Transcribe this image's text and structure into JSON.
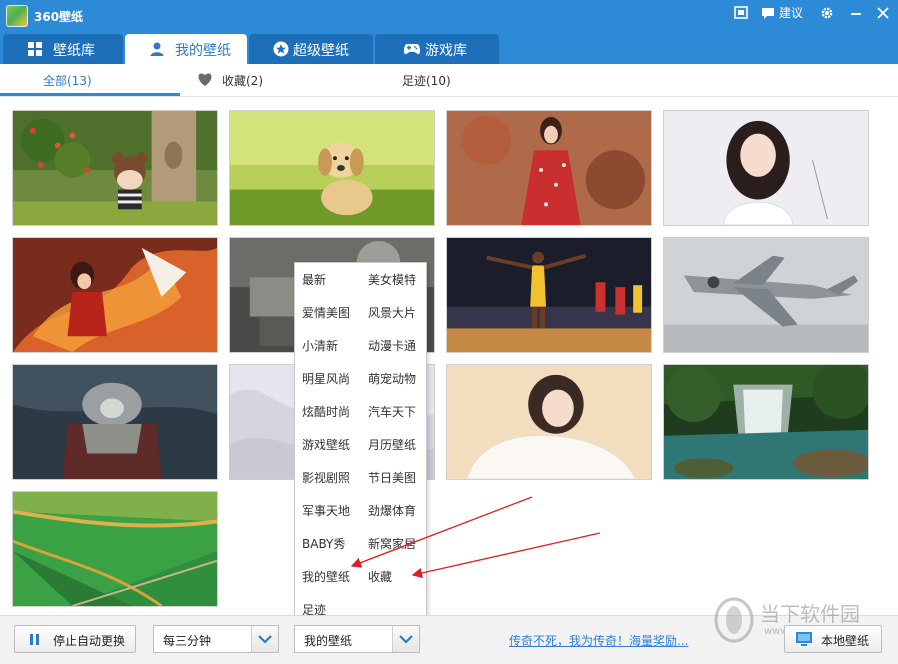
{
  "window": {
    "title": "360壁纸",
    "suggest_label": "建议"
  },
  "main_tabs": [
    {
      "label": "壁纸库",
      "icon": "grid-icon"
    },
    {
      "label": "我的壁纸",
      "icon": "user-icon"
    },
    {
      "label": "超级壁纸",
      "icon": "star-icon"
    },
    {
      "label": "游戏库",
      "icon": "gamepad-icon"
    }
  ],
  "sub_tabs": [
    {
      "label": "全部(13)"
    },
    {
      "label": "收藏(2)",
      "icon": "heart-icon"
    },
    {
      "label": "足迹(10)"
    }
  ],
  "wallpapers": [
    {
      "subject": "figurine-in-garden"
    },
    {
      "subject": "puppy-on-grass"
    },
    {
      "subject": "girl-in-red-dress"
    },
    {
      "subject": "girl-portrait"
    },
    {
      "subject": "game-character-fire"
    },
    {
      "subject": "mech-robot"
    },
    {
      "subject": "basketball-players"
    },
    {
      "subject": "fighter-jet"
    },
    {
      "subject": "masked-warrior"
    },
    {
      "subject": "white-fabric"
    },
    {
      "subject": "girl-in-sunlight"
    },
    {
      "subject": "waterfall"
    },
    {
      "subject": "green-fields"
    }
  ],
  "category_menu": {
    "items": [
      [
        "最新",
        "美女模特"
      ],
      [
        "爱情美图",
        "风景大片"
      ],
      [
        "小清新",
        "动漫卡通"
      ],
      [
        "明星风尚",
        "萌宠动物"
      ],
      [
        "炫酷时尚",
        "汽车天下"
      ],
      [
        "游戏壁纸",
        "月历壁纸"
      ],
      [
        "影视剧照",
        "节日美图"
      ],
      [
        "军事天地",
        "劲爆体育"
      ],
      [
        "BABY秀",
        "新窝家居"
      ],
      [
        "我的壁纸",
        "收藏"
      ],
      [
        "足迹",
        ""
      ]
    ]
  },
  "bottom_bar": {
    "stop_auto_change_label": "停止自动更换",
    "interval_value": "每三分钟",
    "source_value": "我的壁纸",
    "promo_link": "传奇不死，我为传奇！海量奖励...",
    "local_wallpaper_label": "本地壁纸"
  },
  "watermark": {
    "text": "当下软件园",
    "url": "www.downxia.com"
  },
  "colors": {
    "titlebar": "#2d8ad6",
    "tab_inactive": "#1c6fb8",
    "accent": "#2d7bc8",
    "arrow_red": "#e02020",
    "link": "#2e7fd2"
  }
}
